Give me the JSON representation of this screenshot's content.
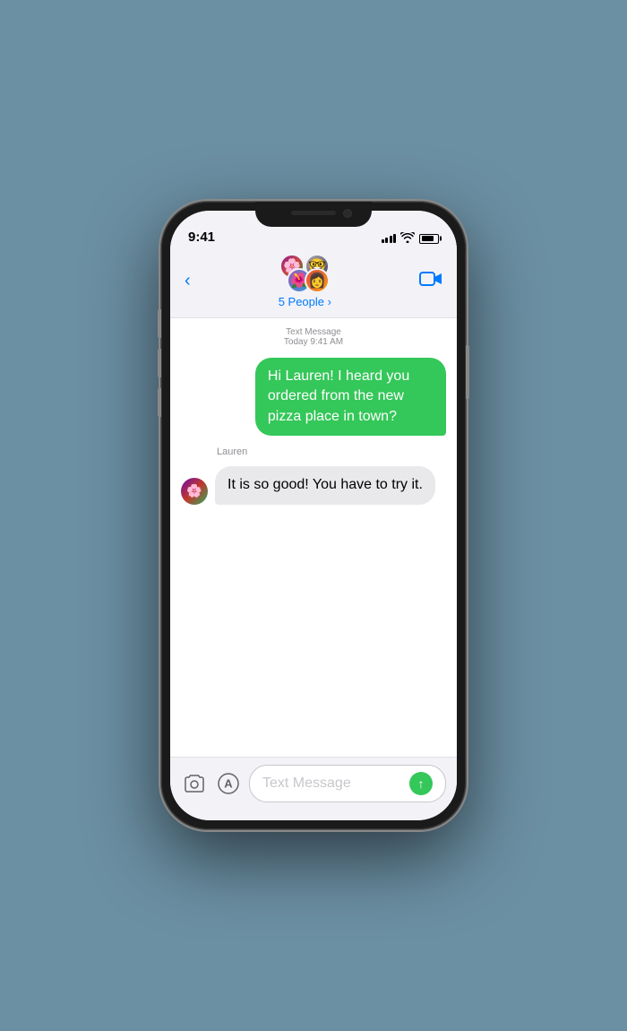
{
  "status": {
    "time": "9:41",
    "signal_bars": [
      3,
      5,
      7,
      9,
      11
    ],
    "battery_level": "80%"
  },
  "header": {
    "back_label": "",
    "group_name": "5 People",
    "group_name_chevron": "›",
    "video_label": "video"
  },
  "messages": {
    "meta_service": "Text Message",
    "meta_time": "Today 9:41 AM",
    "outgoing_text": "Hi Lauren! I heard you ordered from the new pizza place in town?",
    "incoming_sender": "Lauren",
    "incoming_text": "It is so good! You have to try it."
  },
  "input": {
    "placeholder": "Text Message",
    "camera_icon": "📷",
    "apps_icon": "🅰"
  }
}
